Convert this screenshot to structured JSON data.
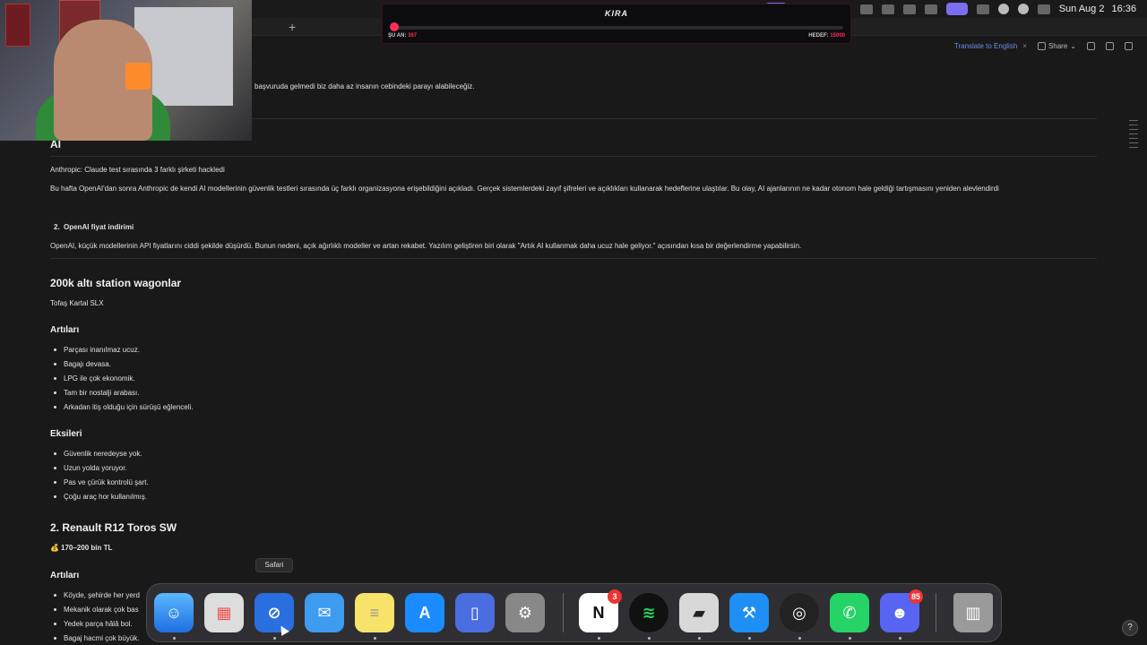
{
  "menubar": {
    "day": "Sun Aug 2",
    "time": "16:36"
  },
  "kira": {
    "title": "KIRA",
    "current_label": "ŞU AN:",
    "current_value": "367",
    "target_label": "HEDEF:",
    "target_value": "15000"
  },
  "browser": {
    "new_tab": "+"
  },
  "notion_header": {
    "translate": "Translate to English",
    "translate_close": "×",
    "share": "Share",
    "share_chevron": "⌄"
  },
  "doc": {
    "intro_line": "başvuruda gelmedi biz daha az insanın cebindeki parayı alabileceğiz.",
    "ai_heading": "AI",
    "item1_title": "Anthropic: Claude test sırasında 3 farklı şirketi hackledi",
    "item1_body": "Bu hafta OpenAI'dan sonra Anthropic de kendi AI modellerinin güvenlik testleri sırasında üç farklı organizasyona erişebildiğini açıkladı. Gerçek sistemlerdeki zayıf şifreleri ve açıklıkları kullanarak hedeflerine ulaştılar. Bu olay, AI ajanlarının ne kadar otonom hale geldiği tartışmasını yeniden alevlendirdi",
    "item2_num": "2.",
    "item2_title": "OpenAI fiyat indirimi",
    "item2_body": "OpenAI, küçük modellerinin API fiyatlarını ciddi şekilde düşürdü. Bunun nedeni, açık ağırlıklı modeller ve artan rekabet. Yazılım geliştiren biri olarak \"Artık AI kullanmak daha ucuz hale geliyor.\" açısından kısa bir değerlendirme yapabilirsin.",
    "wagon_heading": "200k altı station wagonlar",
    "car1_name": "Tofaş Kartal SLX",
    "pros_heading": "Artıları",
    "pros": [
      "Parçası inanılmaz ucuz.",
      "Bagajı devasa.",
      "LPG ile çok ekonomik.",
      "Tam bir nostalji arabası.",
      "Arkadan itiş olduğu için sürüşü eğlenceli."
    ],
    "cons_heading": "Eksileri",
    "cons": [
      "Güvenlik neredeyse yok.",
      "Uzun yolda yoruyor.",
      "Pas ve çürük kontrolü şart.",
      "Çoğu araç hor kullanılmış."
    ],
    "car2_heading": "2. Renault R12 Toros SW",
    "car2_price_icon": "💰",
    "car2_price": "170–200 bin TL",
    "pros2_heading": "Artıları",
    "pros2": [
      "Köyde, şehirde her yerd",
      "Mekanik olarak çok bas",
      "Yedek parça hâlâ bol.",
      "Bagaj hacmi çok büyük."
    ]
  },
  "dock": {
    "tooltip": "Safari",
    "notion_badge": "3",
    "discord_badge": "85",
    "icons": [
      "finder-icon",
      "launchpad-icon",
      "safari-icon",
      "mail-icon",
      "notes-icon",
      "app-store-icon",
      "simulator-icon",
      "system-settings-icon",
      "notion-icon",
      "spotify-icon",
      "iterm-icon",
      "xcode-icon",
      "obs-icon",
      "whatsapp-icon",
      "discord-icon",
      "trash-icon"
    ]
  },
  "help": "?"
}
